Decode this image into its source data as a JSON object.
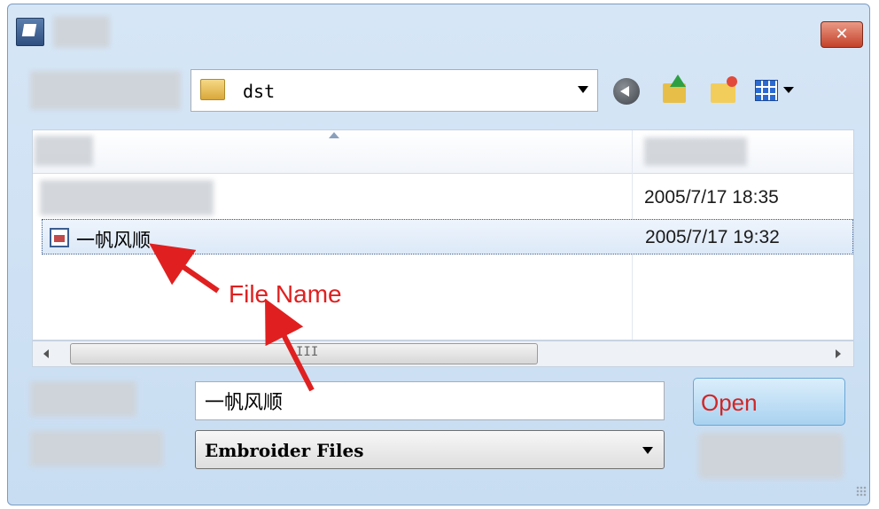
{
  "window": {
    "close_symbol": "✕",
    "icon": "app-window-icon"
  },
  "toolbar": {
    "path_value": "dst",
    "path_icon": "folder-icon",
    "back_icon": "back-arrow-icon",
    "up_icon": "up-folder-icon",
    "new_folder_icon": "new-folder-icon",
    "view_menu_icon": "view-menu-icon"
  },
  "file_list": {
    "rows": [
      {
        "name": "",
        "date": "2005/7/17 18:35",
        "selected": false
      },
      {
        "name": "一帆风顺",
        "date": "2005/7/17 19:32",
        "selected": true
      }
    ]
  },
  "scrollbar": {
    "grip": "III"
  },
  "form": {
    "file_name_value": "一帆风顺",
    "file_type_value": "Embroider Files",
    "open_label": "Open"
  },
  "annotation": {
    "text": "File Name",
    "color": "#e02020"
  },
  "colors": {
    "selection": "#dce9f8",
    "open_button": "#a9d2f0",
    "annotation_red": "#e02020"
  }
}
